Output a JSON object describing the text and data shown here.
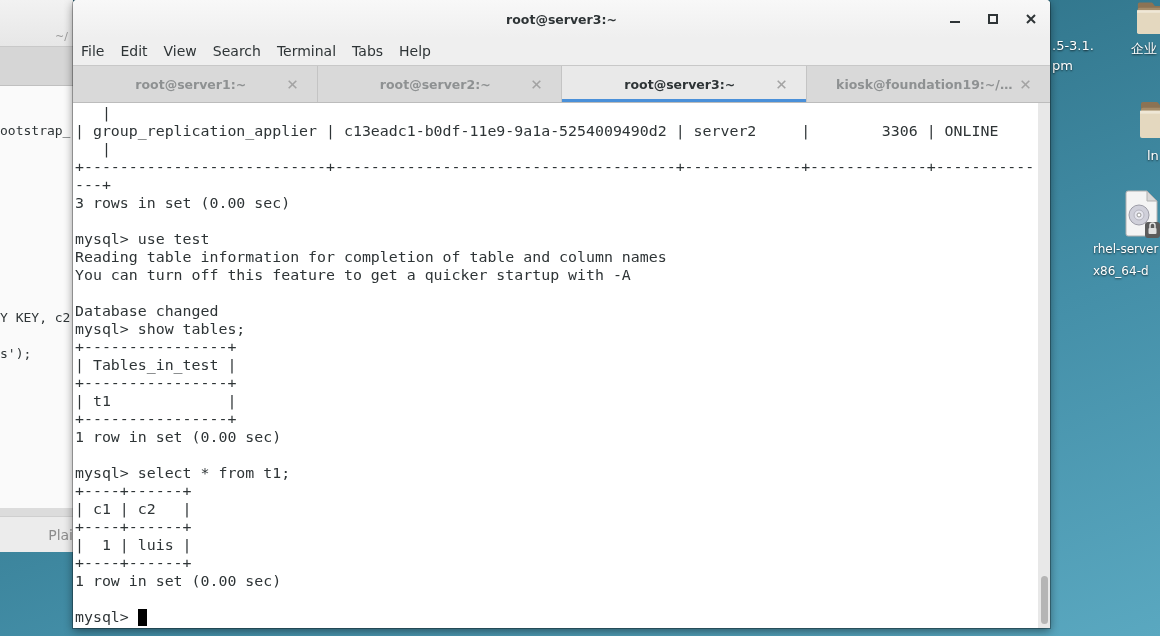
{
  "editor_window": {
    "title": "~/",
    "lines": [
      "ootstrap_",
      "Y KEY, c2",
      "s');"
    ],
    "status": "Plai"
  },
  "terminal_window": {
    "title": "root@server3:~",
    "menu": [
      "File",
      "Edit",
      "View",
      "Search",
      "Terminal",
      "Tabs",
      "Help"
    ],
    "tabs": [
      {
        "label": "root@server1:~",
        "selected": false
      },
      {
        "label": "root@server2:~",
        "selected": false
      },
      {
        "label": "root@server3:~",
        "selected": true
      },
      {
        "label": "kiosk@foundation19:~/…",
        "selected": false
      }
    ],
    "output_blocks": [
      [
        "   |",
        "| group_replication_applier | c13eadc1-b0df-11e9-9a1a-5254009490d2 | server2     |        3306 | ONLINE",
        "   |",
        "+---------------------------+--------------------------------------+-------------+-------------+-----------",
        "---+",
        "3 rows in set (0.00 sec)"
      ],
      [
        "mysql> use test",
        "Reading table information for completion of table and column names",
        "You can turn off this feature to get a quicker startup with -A"
      ],
      [
        "Database changed",
        "mysql> show tables;",
        "+----------------+",
        "| Tables_in_test |",
        "+----------------+",
        "| t1             |",
        "+----------------+",
        "1 row in set (0.00 sec)"
      ],
      [
        "mysql> select * from t1;",
        "+----+------+",
        "| c1 | c2   |",
        "+----+------+",
        "|  1 | luis |",
        "+----+------+",
        "1 row in set (0.00 sec)"
      ]
    ],
    "prompt": "mysql> "
  },
  "desktop": {
    "covered_label": [
      ".5-3.1.",
      "pm"
    ],
    "icons": [
      {
        "kind": "folder",
        "label": [
          "企业"
        ]
      },
      {
        "kind": "folder",
        "label": [
          "ln"
        ]
      },
      {
        "kind": "disc",
        "label": [
          "rhel-server",
          "x86_64-d"
        ]
      }
    ]
  }
}
